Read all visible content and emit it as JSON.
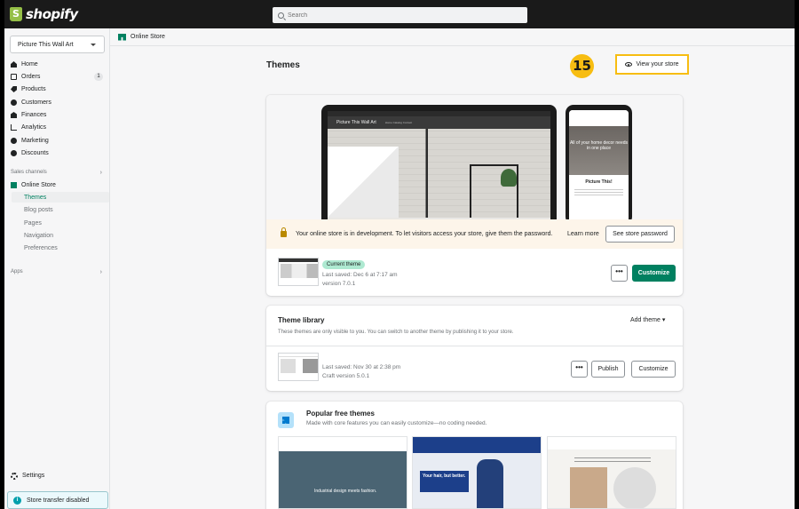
{
  "brand": {
    "name": "shopify"
  },
  "search": {
    "placeholder": "Search"
  },
  "sidebar": {
    "store_name": "Picture This Wall Art",
    "items": [
      {
        "label": "Home",
        "icon": "home-icon"
      },
      {
        "label": "Orders",
        "icon": "orders-icon",
        "badge": "1"
      },
      {
        "label": "Products",
        "icon": "tag-icon"
      },
      {
        "label": "Customers",
        "icon": "person-icon"
      },
      {
        "label": "Finances",
        "icon": "bank-icon"
      },
      {
        "label": "Analytics",
        "icon": "bar-chart-icon"
      },
      {
        "label": "Marketing",
        "icon": "target-icon"
      },
      {
        "label": "Discounts",
        "icon": "discount-icon"
      }
    ],
    "sales_channels_label": "Sales channels",
    "online_store_label": "Online Store",
    "sub_items": [
      "Themes",
      "Blog posts",
      "Pages",
      "Navigation",
      "Preferences"
    ],
    "apps_label": "Apps",
    "settings_label": "Settings",
    "transfer_label": "Store transfer disabled"
  },
  "breadcrumb": {
    "label": "Online Store"
  },
  "main": {
    "title": "Themes",
    "step_number": "15",
    "view_store_label": "View your store",
    "preview": {
      "laptop_brand": "Picture This Wall Art",
      "laptop_links": "Home   Catalog   Contact",
      "phone_hero": "All of your home decor needs in one place",
      "phone_title": "Picture This!"
    },
    "banner": {
      "text": "Your online store is in development. To let visitors access your store, give them the password.",
      "learn_more": "Learn more",
      "password_button": "See store password"
    },
    "current": {
      "badge": "Current theme",
      "last_saved": "Last saved: Dec 6 at 7:17 am",
      "version": "version 7.0.1",
      "more_label": "•••",
      "customize_label": "Customize"
    },
    "library": {
      "title": "Theme library",
      "description": "These themes are only visible to you. You can switch to another theme by publishing it to your store.",
      "add_theme": "Add theme",
      "last_saved": "Last saved: Nov 30 at 2:38 pm",
      "version": "Craft version 5.0.1",
      "more_label": "•••",
      "publish_label": "Publish",
      "customize_label": "Customize"
    },
    "popular": {
      "title": "Popular free themes",
      "description": "Made with core features you can easily customize—no coding needed.",
      "theme1_caption": "Industrial design meets fashion.",
      "theme2_caption": "Your hair, but better."
    }
  },
  "colors": {
    "accent": "#008060",
    "highlight": "#f7bd12",
    "topbar": "#1a1a1a"
  }
}
